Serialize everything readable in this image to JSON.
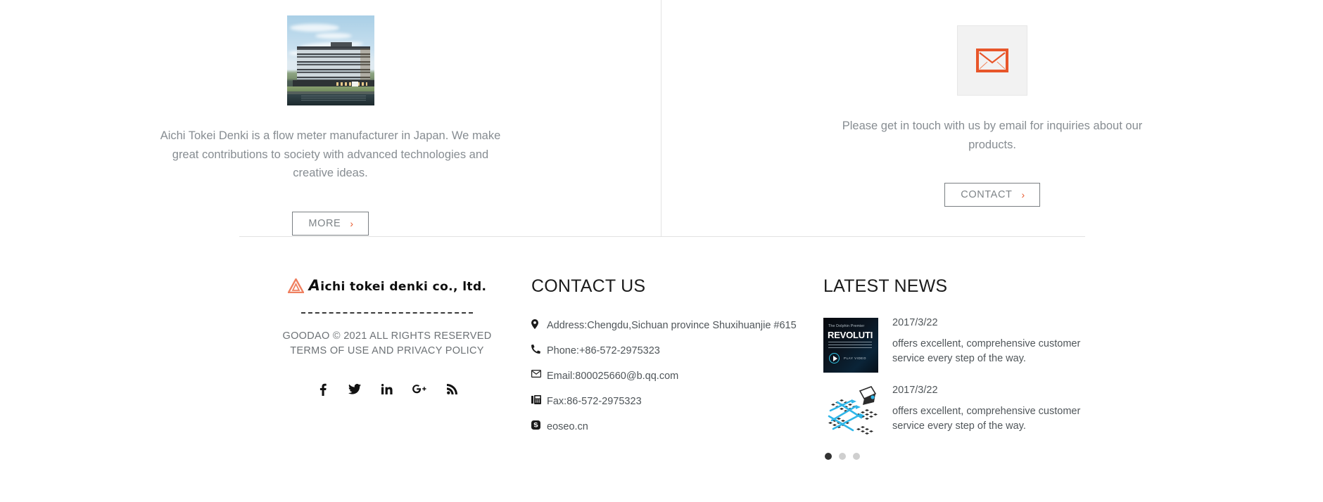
{
  "promo": {
    "left": {
      "image_name": "aichi-tokei-denki-headquarters-building-photo",
      "text": "Aichi Tokei Denki is a flow meter manufacturer in Japan. We make great contributions to society with advanced technologies and creative ideas.",
      "button_label": "MORE",
      "button_chevron": "›"
    },
    "right": {
      "icon_name": "envelope-icon",
      "text": "Please get in touch with us by email for inquiries about our products.",
      "button_label": "CONTACT",
      "button_chevron": "›"
    }
  },
  "footer": {
    "brand": {
      "logo_mark": "orange-triangle-logo",
      "logo_text_lead": "A",
      "logo_text_rest": "ichi tokei denki co., ltd.",
      "copyright_line1": "GOODAO © 2021 ALL RIGHTS RESERVED",
      "copyright_line2": "TERMS OF USE AND PRIVACY POLICY",
      "socials": [
        {
          "name": "facebook-icon",
          "glyph": "f"
        },
        {
          "name": "twitter-icon",
          "glyph": "t"
        },
        {
          "name": "linkedin-icon",
          "glyph": "in"
        },
        {
          "name": "google-plus-icon",
          "glyph": "G+"
        },
        {
          "name": "rss-icon",
          "glyph": "rss"
        }
      ]
    },
    "contact": {
      "heading": "CONTACT US",
      "items": [
        {
          "icon": "location-pin-icon",
          "text": "Address:Chengdu,Sichuan province Shuxihuanjie #615"
        },
        {
          "icon": "phone-icon",
          "text": "Phone:+86-572-2975323"
        },
        {
          "icon": "envelope-icon",
          "text": "Email:800025660@b.qq.com"
        },
        {
          "icon": "fax-icon",
          "text": "Fax:86-572-2975323"
        },
        {
          "icon": "skype-icon",
          "text": "eoseo.cn"
        }
      ]
    },
    "news": {
      "heading": "LATEST NEWS",
      "items": [
        {
          "thumb": "dolphin-premier-revolution-video-thumbnail",
          "thumb_sub": "The Dolphin Premier",
          "thumb_title": "REVOLUTI",
          "thumb_play_label": "PLAY VIDEO",
          "date": "2017/3/22",
          "desc": "offers excellent, comprehensive customer service every step of the way."
        },
        {
          "thumb": "isometric-network-routing-illustration",
          "date": "2017/3/22",
          "desc": "offers excellent, comprehensive customer service every step of the way."
        }
      ],
      "pagination": {
        "total": 3,
        "active": 1
      }
    }
  },
  "colors": {
    "accent_orange": "#e8582c",
    "logo_salmon": "#f08a6d",
    "text_gray": "#878d92",
    "text_dark": "#1b1b1b",
    "rule_gray": "#e2e2e2",
    "tile_gray": "#f2f2f2",
    "dot_active": "#333333",
    "dot_inactive": "#cfcfcf"
  }
}
